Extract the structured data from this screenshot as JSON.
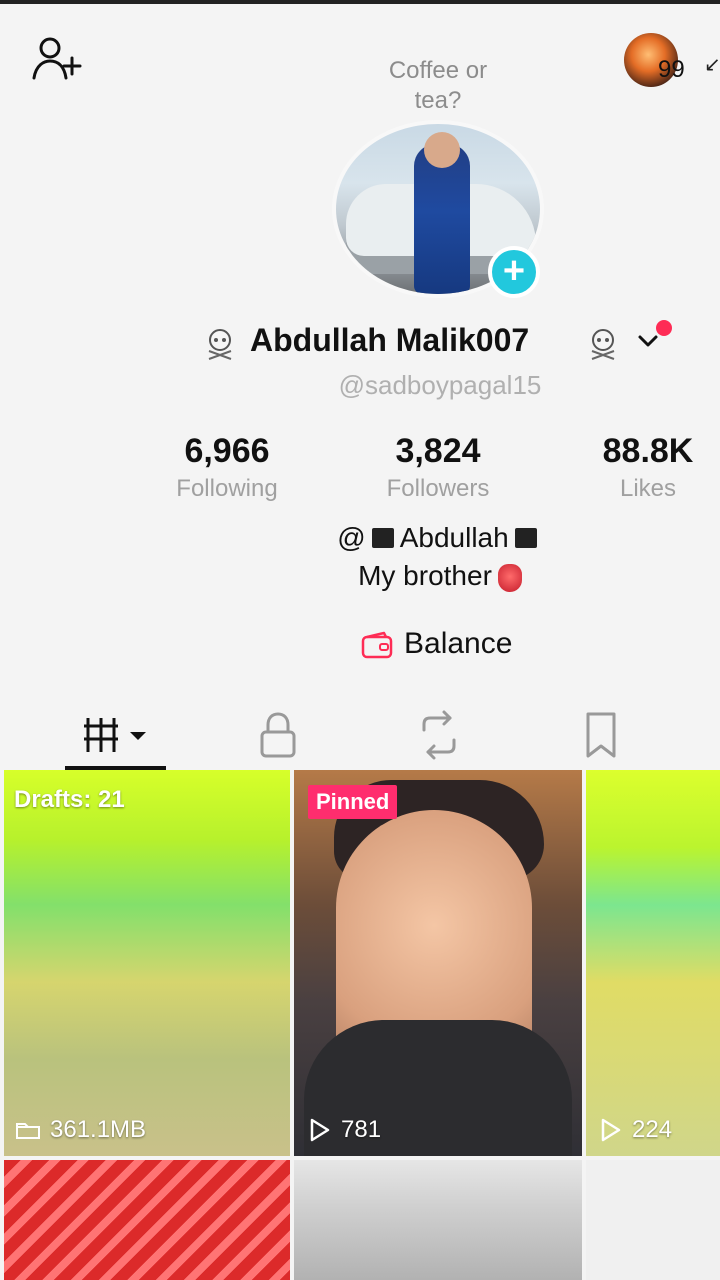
{
  "profile": {
    "coffee_prompt": "Coffee or tea?",
    "display_name": "Abdullah Malik007",
    "username": "@sadboypagal15",
    "right_count": "99"
  },
  "stats": {
    "following": {
      "value": "6,966",
      "label": "Following"
    },
    "followers": {
      "value": "3,824",
      "label": "Followers"
    },
    "likes": {
      "value": "88.8K",
      "label": "Likes"
    }
  },
  "bio": {
    "line1_prefix": "@",
    "line1_name": "Abdullah",
    "line2": "My brother"
  },
  "balance": {
    "label": "Balance"
  },
  "grid": {
    "drafts_label": "Drafts: 21",
    "drafts_size": "361.1MB",
    "pinned_label": "Pinned",
    "pinned_views": "781",
    "third_views": "224"
  },
  "icons": {
    "add_friend": "add-friend-icon",
    "wallet": "wallet-icon",
    "videos": "videos-grid-icon",
    "lock": "lock-icon",
    "repost": "repost-icon",
    "saved": "bookmark-icon",
    "play": "play-icon",
    "folder": "folder-icon"
  },
  "colors": {
    "accent_pink": "#fe2c55",
    "plus_cyan": "#22c8dd"
  }
}
